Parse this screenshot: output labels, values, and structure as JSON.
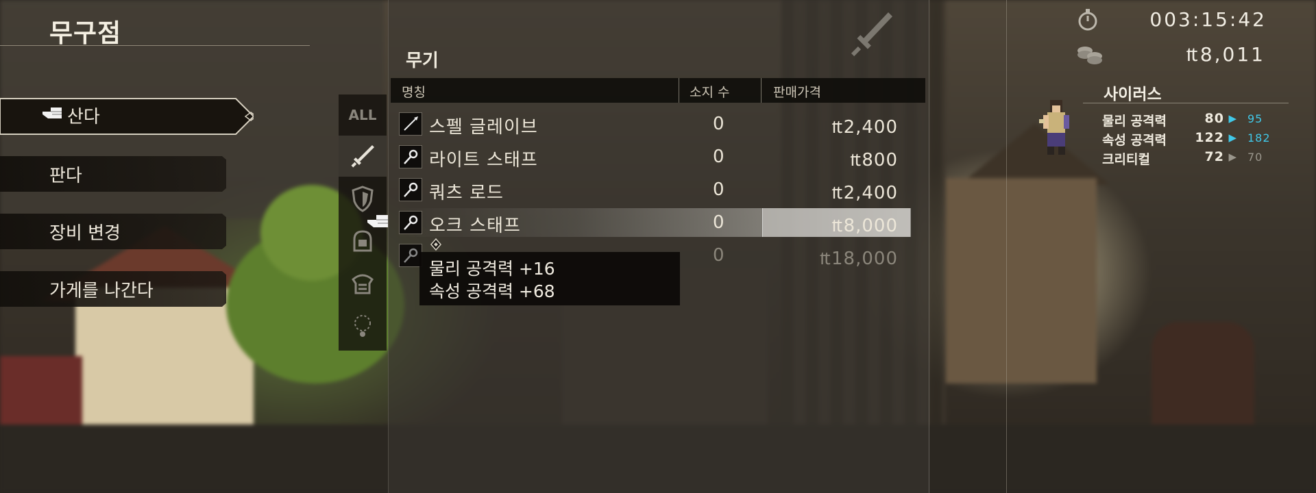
{
  "shop_title": "무구점",
  "menu": [
    {
      "label": "산다",
      "selected": true
    },
    {
      "label": "판다",
      "selected": false
    },
    {
      "label": "장비 변경",
      "selected": false
    },
    {
      "label": "가게를 나간다",
      "selected": false
    }
  ],
  "tabs": [
    {
      "label": "ALL",
      "icon": "all-icon"
    },
    {
      "icon": "sword-icon"
    },
    {
      "icon": "shield-icon"
    },
    {
      "icon": "helmet-icon"
    },
    {
      "icon": "armor-icon"
    },
    {
      "icon": "accessory-icon"
    }
  ],
  "category_title": "무기",
  "columns": {
    "name": "명칭",
    "owned": "소지 수",
    "price": "판매가격"
  },
  "currency_symbol": "₶",
  "items": [
    {
      "name": "스펠 글레이브",
      "owned": "0",
      "price": "2,400",
      "icon": "glaive-icon"
    },
    {
      "name": "라이트 스태프",
      "owned": "0",
      "price": "800",
      "icon": "staff-icon"
    },
    {
      "name": "쿼츠 로드",
      "owned": "0",
      "price": "2,400",
      "icon": "staff-icon"
    },
    {
      "name": "오크 스태프",
      "owned": "0",
      "price": "8,000",
      "icon": "staff-icon",
      "selected": true
    },
    {
      "name": "",
      "owned": "0",
      "price": "18,000",
      "icon": "staff-icon",
      "faded": true
    }
  ],
  "tooltip": {
    "line1": "물리 공격력 +16",
    "line2": "속성 공격력 +68"
  },
  "play_time": "003:15:42",
  "money": "8,011",
  "character": {
    "name": "사이러스",
    "stats": [
      {
        "label": "물리 공격력",
        "current": "80",
        "new": "95",
        "trend": "up"
      },
      {
        "label": "속성 공격력",
        "current": "122",
        "new": "182",
        "trend": "up"
      },
      {
        "label": "크리티컬",
        "current": "72",
        "new": "70",
        "trend": "same"
      }
    ]
  },
  "colors": {
    "stat_up": "#41c8e8",
    "stat_neutral": "#9a968c"
  }
}
